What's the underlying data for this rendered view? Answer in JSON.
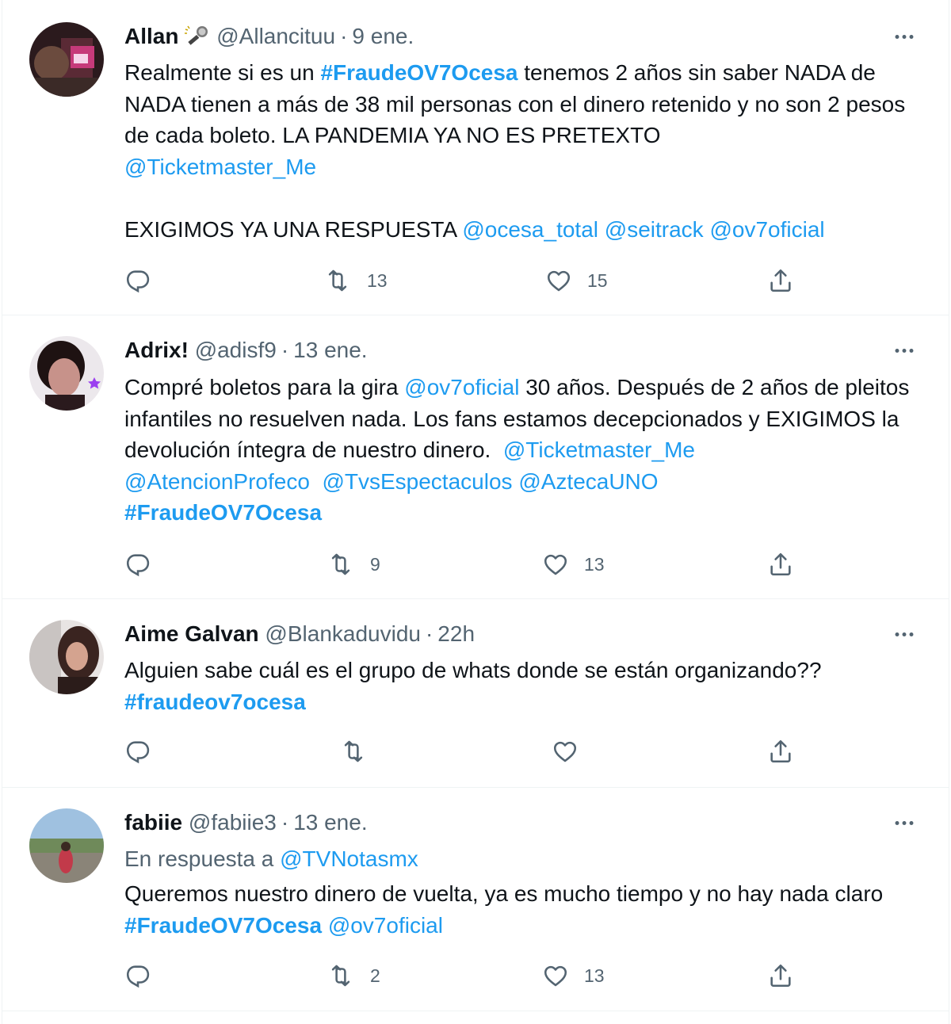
{
  "colors": {
    "link": "#1d9bf0",
    "text": "#0f1419",
    "muted": "#536471",
    "divider": "#eff3f4"
  },
  "tweets": [
    {
      "name": "Allan",
      "name_emoji": "microphone-icon",
      "handle": "@Allancituu",
      "time": "9 ene.",
      "text": [
        "Realmente si es un ",
        "#FraudeOV7Ocesa",
        " tenemos 2 años sin saber NADA de NADA tienen a más de 38 mil personas con el dinero retenido y no son 2 pesos de cada boleto. LA PANDEMIA YA NO ES PRETEXTO ",
        "@Ticketmaster_Me",
        "EXIGIMOS YA UNA RESPUESTA ",
        "@ocesa_total",
        "@seitrack",
        "@ov7oficial"
      ],
      "replies": "",
      "retweets": "13",
      "likes": "15"
    },
    {
      "name": "Adrix!",
      "handle": "@adisf9",
      "time": "13 ene.",
      "text": [
        "Compré boletos para la gira ",
        "@ov7oficial",
        " 30 años. Después de 2 años de pleitos infantiles no resuelven nada. Los fans estamos decepcionados y EXIGIMOS la devolución íntegra de nuestro dinero.  ",
        "@Ticketmaster_Me",
        "@AtencionProfeco",
        "@TvsEspectaculos",
        "@AztecaUNO",
        "#FraudeOV7Ocesa"
      ],
      "replies": "",
      "retweets": "9",
      "likes": "13"
    },
    {
      "name": "Aime Galvan",
      "handle": "@Blankaduvidu",
      "time": "22h",
      "text": [
        "Alguien sabe cuál es el grupo de whats donde se están organizando??",
        "#fraudeov7ocesa"
      ],
      "replies": "",
      "retweets": "",
      "likes": ""
    },
    {
      "name": "fabiie",
      "handle": "@fabiie3",
      "time": "13 ene.",
      "reply_prefix": "En respuesta a ",
      "reply_to": "@TVNotasmx",
      "text": [
        "Queremos nuestro dinero de vuelta, ya es mucho tiempo y no hay nada claro ",
        "#FraudeOV7Ocesa",
        "@ov7oficial"
      ],
      "replies": "",
      "retweets": "2",
      "likes": "13"
    }
  ]
}
